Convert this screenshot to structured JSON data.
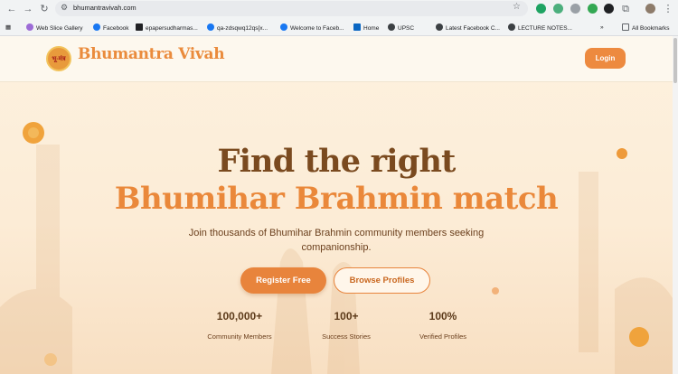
{
  "browser": {
    "url": "bhumantravivah.com",
    "bookmarks": [
      "Web Slice Gallery",
      "Facebook",
      "epapersudharmas...",
      "qa-zdsqwq12qs[x...",
      "Welcome to Faceb...",
      "Home",
      "UPSC",
      "Latest Facebook C...",
      "LECTURE NOTES...",
      "All Bookmarks"
    ],
    "more": "»"
  },
  "header": {
    "logo_text": "भू-मंत्र",
    "brand": "Bhumantra Vivah",
    "login_label": "Login"
  },
  "hero": {
    "title_line1": "Find the right",
    "title_line2": "Bhumihar Brahmin match",
    "subtitle": "Join thousands of Bhumihar Brahmin community members seeking companionship.",
    "register_label": "Register Free",
    "browse_label": "Browse Profiles"
  },
  "stats": [
    {
      "value": "100,000+",
      "label": "Community Members"
    },
    {
      "value": "100+",
      "label": "Success Stories"
    },
    {
      "value": "100%",
      "label": "Verified Profiles"
    }
  ],
  "colors": {
    "accent": "#ed8a3f",
    "title_brown": "#7a4a1f",
    "background": "#fcecd6"
  },
  "icons": [
    "back-arrow-icon",
    "forward-arrow-icon",
    "reload-icon",
    "site-info-icon",
    "bookmark-star-icon",
    "extensions-icon",
    "menu-kebab-icon",
    "apps-grid-icon",
    "folder-icon"
  ]
}
